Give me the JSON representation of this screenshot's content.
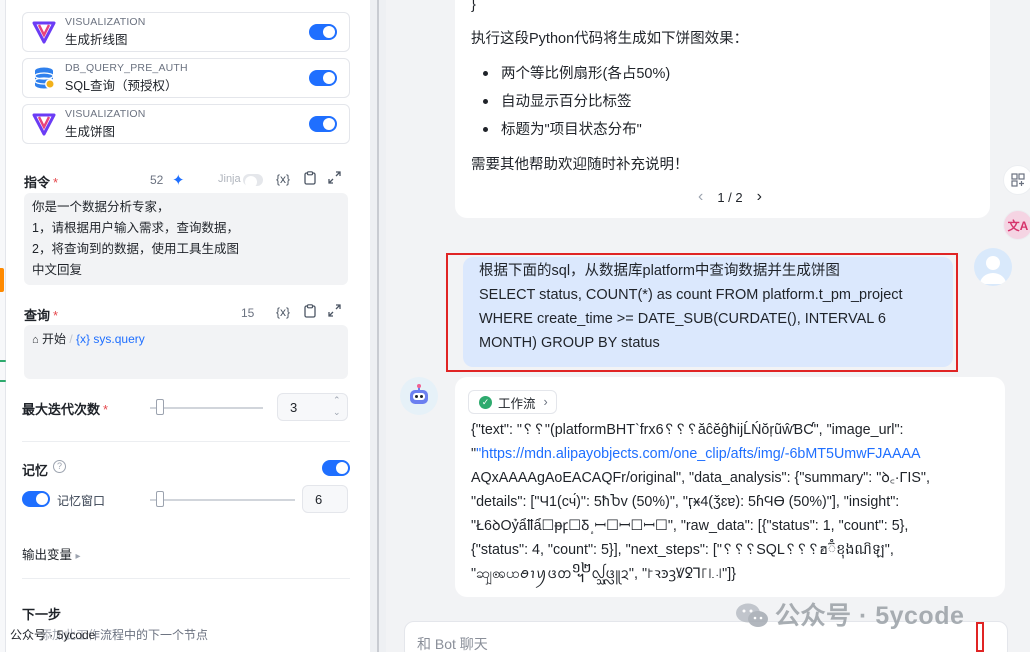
{
  "tools": [
    {
      "category": "VISUALIZATION",
      "name": "生成折线图",
      "icon": "visualization-icon",
      "enabled": true
    },
    {
      "category": "DB_QUERY_PRE_AUTH",
      "name": "SQL查询（预授权）",
      "icon": "database-icon",
      "enabled": true
    },
    {
      "category": "VISUALIZATION",
      "name": "生成饼图",
      "icon": "visualization-icon",
      "enabled": true
    }
  ],
  "instruction": {
    "label": "指令",
    "required_mark": "*",
    "count": "52",
    "jinja_label": "Jinja",
    "var_label": "{x}",
    "lines": [
      "你是一个数据分析专家，",
      "1，请根据用户输入需求，查询数据，",
      "2，将查询到的数据，使用工具生成图",
      "中文回复"
    ]
  },
  "query": {
    "label": "查询",
    "required_mark": "*",
    "count": "15",
    "var_label": "{x}",
    "start_label": "开始",
    "var_token": "{x} sys.query"
  },
  "max_iter": {
    "label": "最大迭代次数",
    "required_mark": "*",
    "value": "3",
    "level": 0.05
  },
  "memory": {
    "label": "记忆",
    "help": "?",
    "window_label": "记忆窗口",
    "window_value": "6",
    "window_level": 0.05,
    "enabled": true,
    "window_enabled": true
  },
  "output_vars": {
    "label": "输出变量",
    "arrow": "▸"
  },
  "next_step": {
    "label": "下一步",
    "desc": "添加此工作流程中的下一个节点"
  },
  "watermark_left": "公众号 · 5ycode",
  "chat": {
    "code_tail": "}",
    "intro": "执行这段Python代码将生成如下饼图效果：",
    "bullets": [
      "两个等比例扇形(各占50%)",
      "自动显示百分比标签",
      "标题为\"项目状态分布\""
    ],
    "closing": "需要其他帮助欢迎随时补充说明！",
    "pager": {
      "prev": "‹",
      "text": "1 / 2",
      "next": "›"
    },
    "user_message_lines": [
      "根据下面的sql，从数据库platform中查询数据并生成饼图",
      "SELECT status, COUNT(*) as count FROM platform.t_pm_project",
      "WHERE create_time >= DATE_SUB(CURDATE(), INTERVAL 6",
      "MONTH) GROUP BY status"
    ],
    "workflow_chip": "工作流",
    "json_lines": [
      "{\"text\": \"␦␦\"(platformBHT`frx6␦␦␦ăĉĕĝħijĹŃŏŗũŵƁƇ\", \"image_url\":",
      "\"https://mdn.alipayobjects.com/one_clip/afts/img/-6bMT5UmwFJAAAA",
      "AQxAAAAgAoEACAQFr/original\", \"data_analysis\": {\"summary\": \"ꝺ͏꜀·ΓΙS\",",
      "\"details\": [\"Ч1(сч́)\": 5ћႦv (50%)\", \"ӷӿ4(ǯɛɐ): 5ɦϤϴ (50%)\"], \"insight\":",
      "\"Ł6ꝺOỷẩỻẩ☐ᵽ͏ꝼ☐Ᵹ﮿ꟷ☐ꟷ☐ꟷ☐\", \"raw_data\": [{\"status\": 1, \"count\": 5},",
      "{\"status\": 4, \"count\": 5}], \"next_steps\": [\"␦␦␦SQL␦␦␦ฮ៊ំខុងណ៝ឡ\",",
      "\"ꩿꩩꩤꪮꪱꪗᨴᨲ᧬ᩓᩞᨴᩖᩪᨯ\", \"꜓ꝛꜿꝫꝞꝿꞀ꜒꜑꜋\"]}"
    ],
    "url_part": "https://mdn.alipayobjects.com/one_clip/afts/img/-6bMT5UmwFJAAAAAQxAAAAgAoEACAQFr/original",
    "input_placeholder": "和 Bot 聊天",
    "watermark": "公众号 · 5ycode"
  },
  "colors": {
    "accent": "#1f6fff",
    "highlight_box": "#e02424",
    "user_bubble": "#dbe8fd"
  }
}
